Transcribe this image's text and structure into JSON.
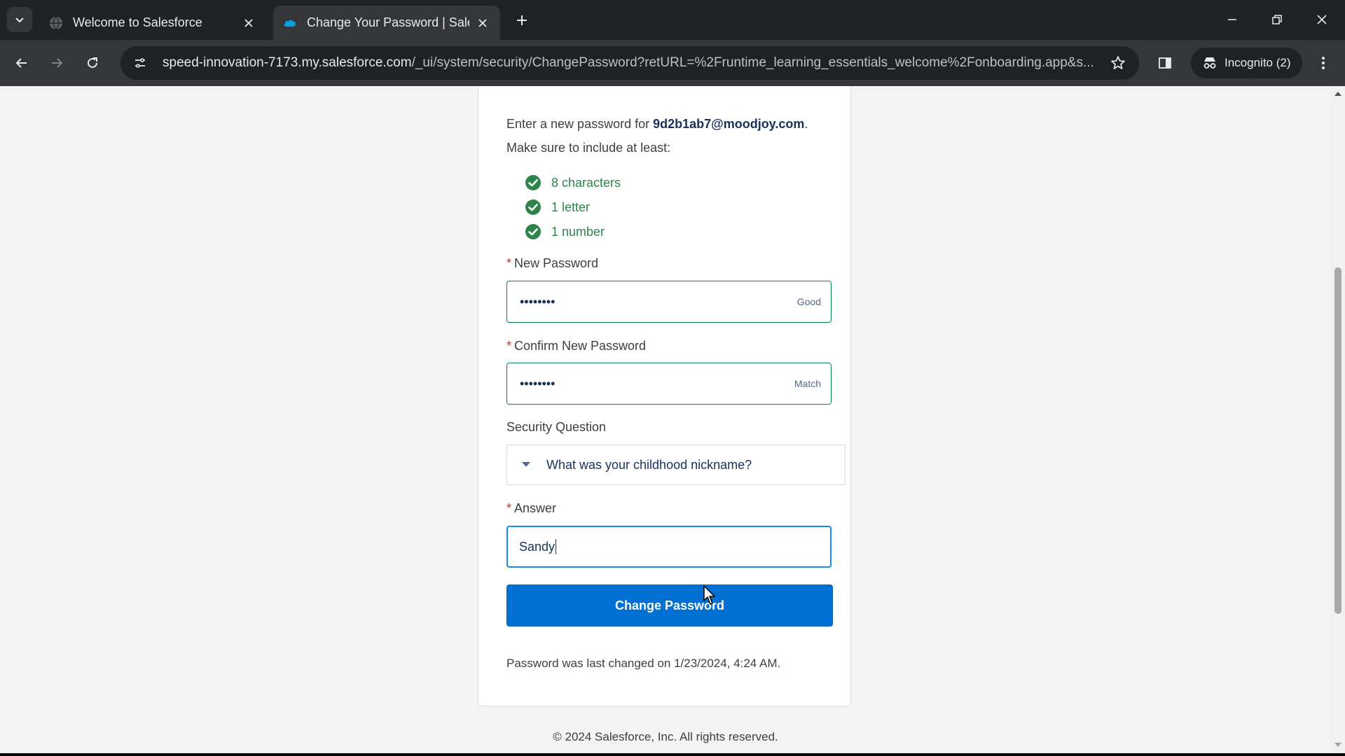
{
  "browser": {
    "tabs": [
      {
        "title": "Welcome to Salesforce",
        "active": false
      },
      {
        "title": "Change Your Password | Salesfo",
        "active": true
      }
    ],
    "url_host": "speed-innovation-7173.my.salesforce.com",
    "url_path": "/_ui/system/security/ChangePassword?retURL=%2Fruntime_learning_essentials_welcome%2Fonboarding.app&s...",
    "incognito_label": "Incognito (2)"
  },
  "form": {
    "intro_prefix": "Enter a new password for ",
    "username": "9d2b1ab7@moodjoy.com",
    "intro_suffix": ".",
    "include_text": "Make sure to include at least:",
    "requirements": [
      "8 characters",
      "1 letter",
      "1 number"
    ],
    "required_marker": "*",
    "new_password_label": "New Password",
    "new_password_value": "••••••••",
    "new_password_hint": "Good",
    "confirm_password_label": "Confirm New Password",
    "confirm_password_value": "••••••••",
    "confirm_password_hint": "Match",
    "security_question_label": "Security Question",
    "security_question_value": "What was your childhood nickname?",
    "answer_label": "Answer",
    "answer_value": "Sandy",
    "submit_label": "Change Password",
    "last_changed": "Password was last changed on 1/23/2024, 4:24 AM."
  },
  "footer": {
    "copyright": "© 2024 Salesforce, Inc. All rights reserved."
  },
  "colors": {
    "success_green": "#2e844a",
    "brand_blue": "#0070d2",
    "focus_blue": "#1589ee"
  },
  "icons": [
    "tab-search-icon",
    "globe-icon",
    "salesforce-cloud-icon",
    "close-icon",
    "plus-icon",
    "minimize-icon",
    "restore-icon",
    "back-icon",
    "forward-icon",
    "reload-icon",
    "site-info-icon",
    "star-icon",
    "side-panel-icon",
    "incognito-icon",
    "kebab-menu-icon",
    "check-circle-icon",
    "chevron-down-icon"
  ]
}
